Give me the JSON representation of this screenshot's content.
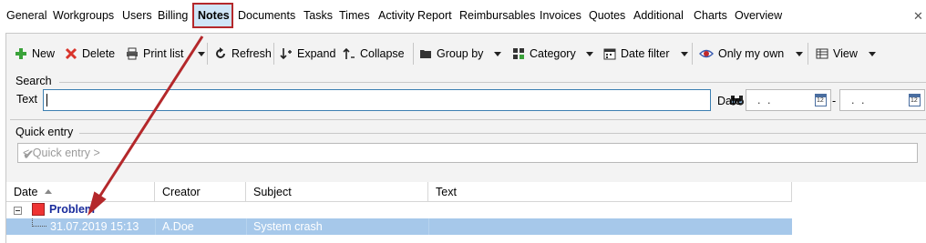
{
  "tabs": [
    "General",
    "Workgroups",
    "Users",
    "Billing",
    "Notes",
    "Documents",
    "Tasks",
    "Times",
    "Activity Report",
    "Reimbursables",
    "Invoices",
    "Quotes",
    "Additional",
    "Charts",
    "Overview"
  ],
  "close_glyph": "✕",
  "toolbar": {
    "new": "New",
    "delete": "Delete",
    "print_list": "Print list",
    "refresh": "Refresh",
    "expand": "Expand",
    "collapse": "Collapse",
    "group_by": "Group by",
    "category": "Category",
    "date_filter": "Date filter",
    "only_my_own": "Only my own",
    "view": "View"
  },
  "search": {
    "legend": "Search",
    "text_label": "Text",
    "text_value": "",
    "date_label": "Date",
    "date_from": ". .",
    "date_to": ". .",
    "range_sep": "-"
  },
  "quick_entry": {
    "legend": "Quick entry",
    "placeholder": "< Quick entry >"
  },
  "grid": {
    "columns": [
      "Date",
      "Creator",
      "Subject",
      "Text"
    ],
    "group": {
      "label": "Problem",
      "color": "#ee3333"
    },
    "rows": [
      {
        "date": "31.07.2019 15:13",
        "creator": "A.Doe",
        "subject": "System crash",
        "text": ""
      }
    ]
  },
  "colors": {
    "selected_row": "#a6c8ea",
    "highlight_border": "#b4282b",
    "group_label": "#1a2c9c"
  }
}
